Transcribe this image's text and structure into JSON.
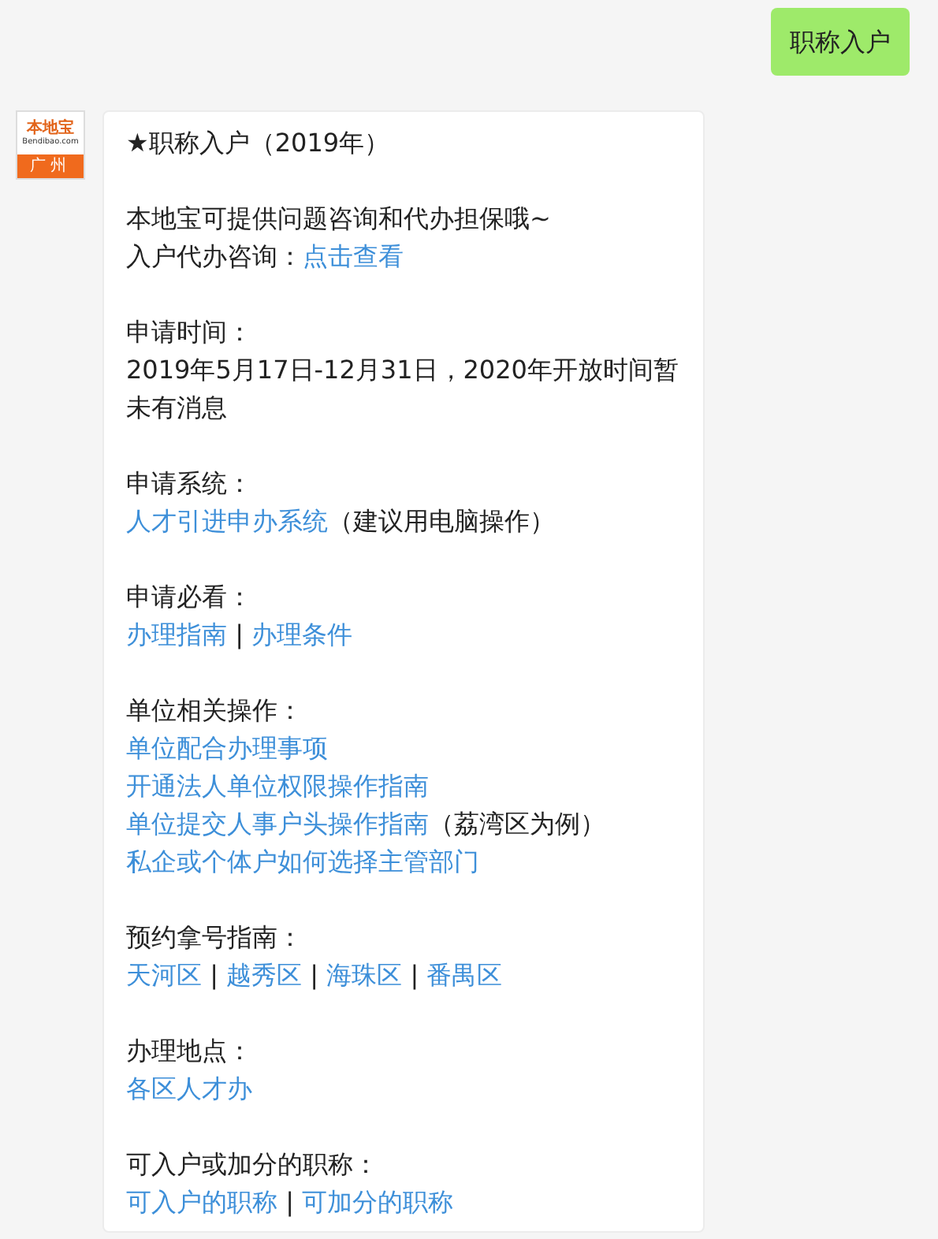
{
  "messages": [
    {
      "kind": "outgoing",
      "text": "职称入户"
    },
    {
      "kind": "incoming",
      "avatar": {
        "title": "本地宝",
        "site": "Bendibao.com",
        "city": "广州"
      },
      "blocks": [
        [
          [
            {
              "kind": "text",
              "text": "★职称入户（2019年）"
            }
          ]
        ],
        [
          [
            {
              "kind": "text",
              "text": "本地宝可提供问题咨询和代办担保哦~"
            }
          ],
          [
            {
              "kind": "text",
              "text": "入户代办咨询："
            },
            {
              "kind": "link",
              "text": "点击查看"
            }
          ]
        ],
        [
          [
            {
              "kind": "text",
              "text": "申请时间："
            }
          ],
          [
            {
              "kind": "text",
              "text": "2019年5月17日-12月31日，2020年开放时间暂未有消息"
            }
          ]
        ],
        [
          [
            {
              "kind": "text",
              "text": "申请系统："
            }
          ],
          [
            {
              "kind": "link",
              "text": "人才引进申办系统"
            },
            {
              "kind": "text",
              "text": "（建议用电脑操作）"
            }
          ]
        ],
        [
          [
            {
              "kind": "text",
              "text": "申请必看："
            }
          ],
          [
            {
              "kind": "link",
              "text": "办理指南"
            },
            {
              "kind": "text",
              "text": " | "
            },
            {
              "kind": "link",
              "text": "办理条件"
            }
          ]
        ],
        [
          [
            {
              "kind": "text",
              "text": "单位相关操作："
            }
          ],
          [
            {
              "kind": "link",
              "text": "单位配合办理事项"
            }
          ],
          [
            {
              "kind": "link",
              "text": "开通法人单位权限操作指南"
            }
          ],
          [
            {
              "kind": "link",
              "text": "单位提交人事户头操作指南"
            },
            {
              "kind": "text",
              "text": "（荔湾区为例）"
            }
          ],
          [
            {
              "kind": "link",
              "text": "私企或个体户如何选择主管部门"
            }
          ]
        ],
        [
          [
            {
              "kind": "text",
              "text": "预约拿号指南："
            }
          ],
          [
            {
              "kind": "link",
              "text": "天河区"
            },
            {
              "kind": "text",
              "text": " | "
            },
            {
              "kind": "link",
              "text": "越秀区"
            },
            {
              "kind": "text",
              "text": " | "
            },
            {
              "kind": "link",
              "text": "海珠区"
            },
            {
              "kind": "text",
              "text": " | "
            },
            {
              "kind": "link",
              "text": "番禺区"
            }
          ]
        ],
        [
          [
            {
              "kind": "text",
              "text": "办理地点："
            }
          ],
          [
            {
              "kind": "link",
              "text": "各区人才办"
            }
          ]
        ],
        [
          [
            {
              "kind": "text",
              "text": "可入户或加分的职称："
            }
          ],
          [
            {
              "kind": "link",
              "text": "可入户的职称"
            },
            {
              "kind": "text",
              "text": " | "
            },
            {
              "kind": "link",
              "text": "可加分的职称"
            }
          ]
        ]
      ]
    }
  ]
}
